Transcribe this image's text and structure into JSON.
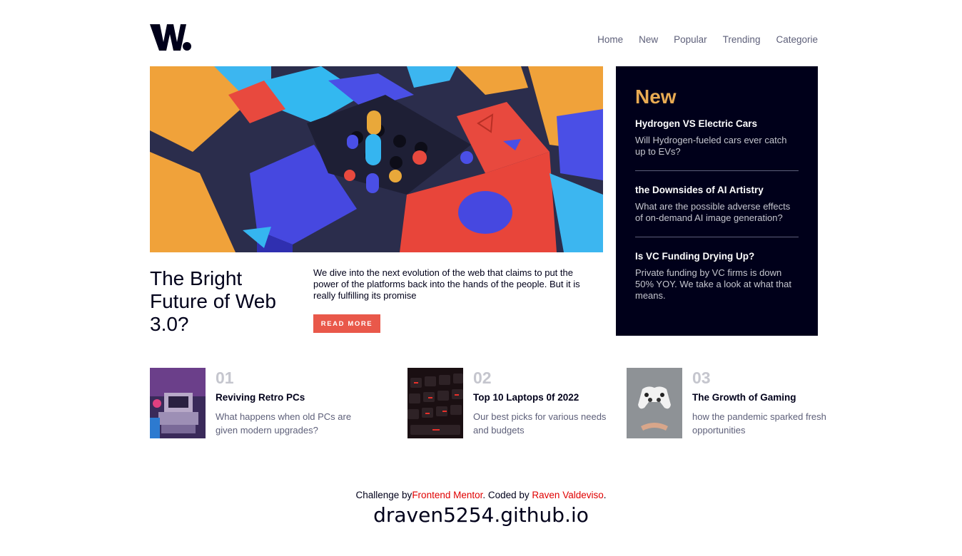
{
  "brand": {
    "logo_text": "W."
  },
  "nav": {
    "items": [
      "Home",
      "New",
      "Popular",
      "Trending",
      "Categorie"
    ]
  },
  "hero": {
    "title": "The Bright Future of Web 3.0?",
    "description": "We dive into the next evolution of the web that claims to put the power of the platforms back into the hands of the people. But it is really fulfilling its promise",
    "button": "READ MORE"
  },
  "new_panel": {
    "heading": "New",
    "items": [
      {
        "title": "Hydrogen VS Electric Cars",
        "desc": "Will Hydrogen-fueled cars ever catch up to EVs?"
      },
      {
        "title": "the Downsides of AI Artistry",
        "desc": "What are the possible adverse effects of on-demand AI image generation?"
      },
      {
        "title": "Is VC Funding Drying Up?",
        "desc": "Private funding by VC firms is down 50% YOY. We take a look at what that means."
      }
    ]
  },
  "cards": [
    {
      "num": "01",
      "title": "Reviving Retro PCs",
      "desc": "What happens when old PCs are given modern upgrades?"
    },
    {
      "num": "02",
      "title": "Top 10 Laptops 0f 2022",
      "desc": "Our best picks for various needs and budgets"
    },
    {
      "num": "03",
      "title": "The Growth of Gaming",
      "desc": "how the pandemic sparked fresh opportunities"
    }
  ],
  "footer": {
    "prefix": "Challenge by",
    "link1": "Frontend Mentor",
    "middle": ". Coded by ",
    "link2": "Raven Valdeviso",
    "suffix": ".",
    "domain": "draven5254.github.io"
  },
  "colors": {
    "accent_red": "#e9584a",
    "accent_gold": "#e9ab53",
    "dark_navy": "#00001a",
    "muted": "#5d5f79"
  }
}
